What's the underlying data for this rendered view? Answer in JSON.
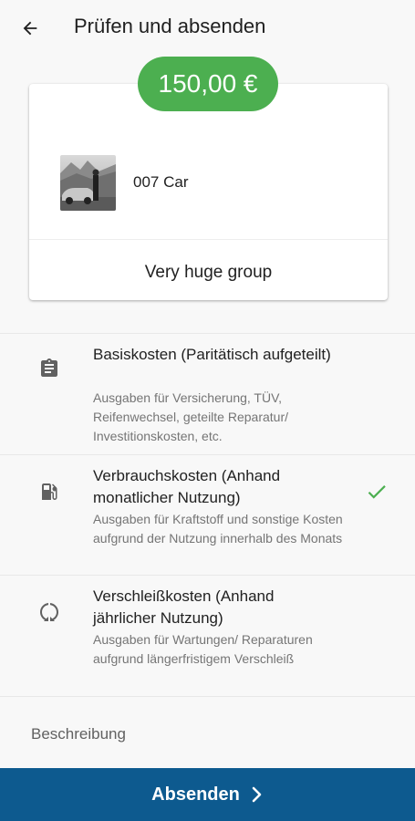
{
  "toolbar": {
    "title": "Prüfen und absenden",
    "back_icon": "arrow-back-icon"
  },
  "summary": {
    "amount": "150,00 €",
    "amount_color": "#4caf50",
    "car_name": "007 Car",
    "car_image": "car-photo",
    "group_name": "Very huge group"
  },
  "cost_types": [
    {
      "title": "Basiskosten (Paritätisch aufgeteilt)",
      "description": "Ausgaben für Versicherung, TÜV, Reifenwechsel, geteilte Reparatur/ Investitionskosten, etc.",
      "icon": "clipboard-icon",
      "selected": false
    },
    {
      "title": "Verbrauchskosten (Anhand monatlicher Nutzung)",
      "description": "Ausgaben für Kraftstoff und sonstige Kosten aufgrund der Nutzung innerhalb des Monats",
      "icon": "fuel-pump-icon",
      "selected": true
    },
    {
      "title": "Verschleißkosten (Anhand jährlicher Nutzung)",
      "description": "Ausgaben für Wartungen/ Reparaturen aufgrund längerfristigem Verschleiß",
      "icon": "circular-progress-icon",
      "selected": false
    }
  ],
  "description_field": {
    "label": "Beschreibung"
  },
  "submit": {
    "label": "Absenden",
    "color": "#0d5a8f"
  },
  "colors": {
    "check": "#4caf50",
    "icon_gray": "#616161"
  }
}
